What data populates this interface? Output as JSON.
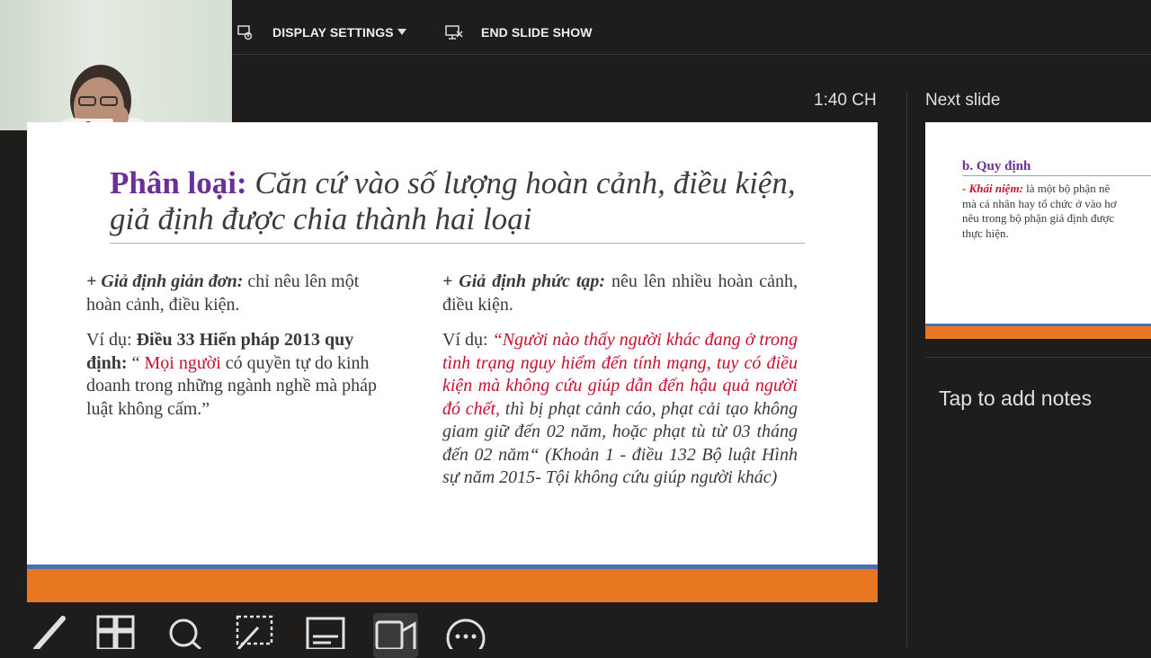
{
  "toolbar": {
    "display_settings": "DISPLAY SETTINGS",
    "end_slide_show": "END SLIDE SHOW"
  },
  "clock": "1:40 CH",
  "current_slide": {
    "title_label": "Phân loại:",
    "title_rest": " Căn cứ vào số lượng hoàn cảnh, điều kiện, giả định được chia thành hai loại",
    "left": {
      "heading": "+ Giả định giản đơn:",
      "heading_text": " chỉ nêu lên một hoàn cảnh, điều kiện.",
      "example_prefix": "Ví dụ: ",
      "example_bold": "Điều 33 Hiến pháp 2013 quy định:",
      "example_quote_open": " “ ",
      "example_red": "Mọi người",
      "example_rest": " có quyền tự do kinh doanh trong những ngành nghề mà pháp luật không cấm.”"
    },
    "right": {
      "heading": "+ Giả định phức tạp:",
      "heading_text": " nêu lên nhiều hoàn cảnh, điều kiện.",
      "example_prefix": "Ví dụ: ",
      "example_red": "“Người nào thấy người khác đang ở trong tình trạng nguy hiểm đến tính mạng, tuy có điều kiện mà không cứu giúp dẫn đến hậu quả người đó chết,",
      "example_rest": " thì bị phạt cảnh cáo, phạt cải tạo không giam giữ đến 02 năm, hoặc phạt tù từ 03 tháng đến 02 năm“ (Khoản 1 - điều 132 Bộ luật Hình sự năm 2015- Tội không cứu giúp người khác)"
    }
  },
  "next_slide": {
    "label": "Next slide",
    "title": "b. Quy định",
    "line1_red": "- Khái niệm:",
    "line1_rest": " là một bộ phận nê",
    "line2": "mà cá nhân hay tổ chức ở vào hơ",
    "line3": "nêu trong bộ phận giả định được",
    "line4": "thực hiện."
  },
  "notes_placeholder": "Tap to add notes",
  "colors": {
    "background": "#1e1d1c",
    "title_purple": "#6b2f95",
    "accent_red": "#c8102e",
    "stripe_orange": "#e87722",
    "stripe_blue": "#4a6fb0"
  },
  "icons": [
    "display-settings-icon",
    "caret-down-icon",
    "end-slideshow-icon",
    "pen-icon",
    "slide-grid-icon",
    "zoom-icon",
    "pointer-icon",
    "subtitles-icon",
    "camera-icon",
    "more-options-icon"
  ]
}
